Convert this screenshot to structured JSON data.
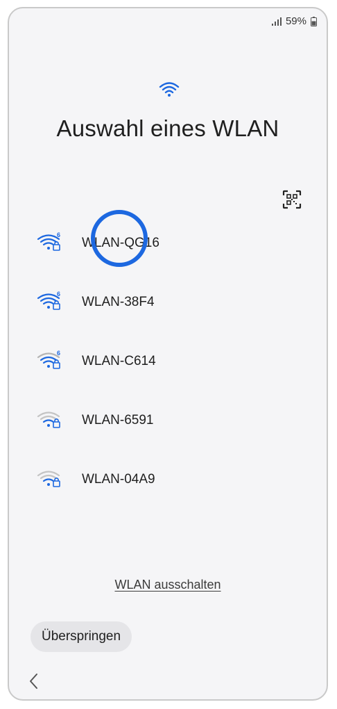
{
  "status_bar": {
    "battery_percent": "59%",
    "icons": [
      "signal-icon",
      "battery-icon"
    ]
  },
  "header": {
    "icon": "wifi-icon",
    "title": "Auswahl eines WLAN"
  },
  "qr_scan": {
    "icon": "qr-code-scan-icon"
  },
  "networks": [
    {
      "ssid": "WLAN-QG16",
      "secured": true,
      "wifi6": true,
      "signal": "strong",
      "color": "#1d68e0"
    },
    {
      "ssid": "WLAN-38F4",
      "secured": true,
      "wifi6": true,
      "signal": "strong",
      "color": "#1d68e0"
    },
    {
      "ssid": "WLAN-C614",
      "secured": true,
      "wifi6": true,
      "signal": "medium",
      "color": "#1d68e0"
    },
    {
      "ssid": "WLAN-6591",
      "secured": true,
      "wifi6": false,
      "signal": "weak",
      "color": "#9e9e9e"
    },
    {
      "ssid": "WLAN-04A9",
      "secured": true,
      "wifi6": false,
      "signal": "weak",
      "color": "#9e9e9e"
    }
  ],
  "footer": {
    "wifi_off_link": "WLAN ausschalten",
    "skip_button": "Überspringen",
    "back_icon": "chevron-left-icon"
  },
  "colors": {
    "accent": "#1d68e0",
    "background": "#f5f5f7",
    "skip_button_bg": "#e5e5e8"
  }
}
